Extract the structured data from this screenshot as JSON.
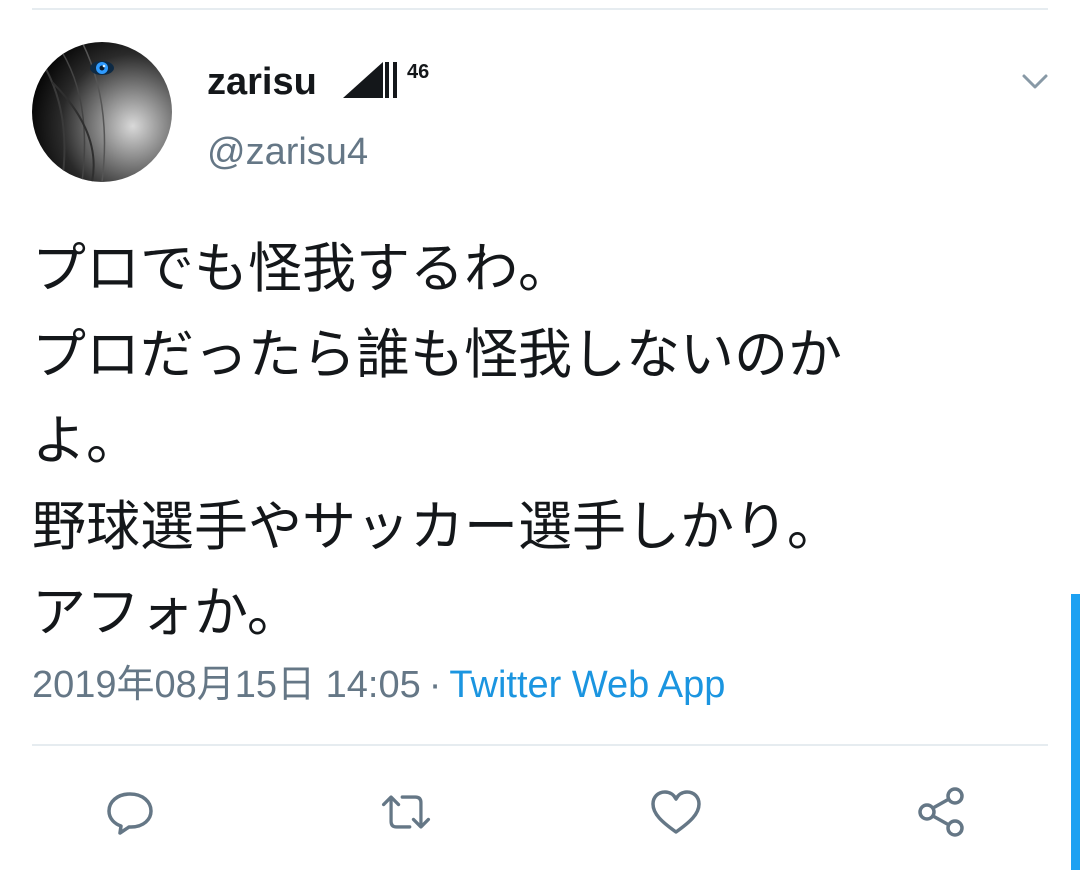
{
  "user": {
    "display_name": "zarisu",
    "badge_text": "46",
    "handle": "@zarisu4"
  },
  "tweet": {
    "lines": [
      "プロでも怪我するわ。",
      "プロだったら誰も怪我しないのか",
      "よ。",
      "野球選手やサッカー選手しかり。",
      "アフォか。"
    ]
  },
  "meta": {
    "timestamp": "2019年08月15日 14:05",
    "separator": "·",
    "source": "Twitter Web App"
  },
  "actions": {
    "icons": [
      "reply-icon",
      "retweet-icon",
      "like-icon",
      "share-icon"
    ]
  },
  "colors": {
    "text": "#14171a",
    "secondary": "#657786",
    "link": "#1b95e0",
    "divider": "#e6ecf0",
    "scrollbar": "#1da1f2"
  }
}
